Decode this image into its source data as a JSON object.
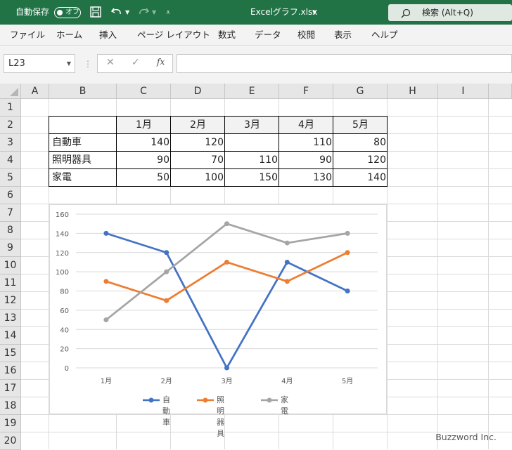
{
  "titlebar": {
    "autosave_label": "自動保存",
    "autosave_state": "オフ",
    "file_name": "Excelグラフ.xlsx",
    "search_label": "検索 (Alt+Q)",
    "bg_color": "#217346"
  },
  "menu": [
    "ファイル",
    "ホーム",
    "挿入",
    "ページ レイアウト",
    "数式",
    "データ",
    "校閲",
    "表示",
    "ヘルプ"
  ],
  "formula_bar": {
    "name_box": "L23",
    "fx": "fx",
    "formula": ""
  },
  "columns": [
    "A",
    "B",
    "C",
    "D",
    "E",
    "F",
    "G",
    "H",
    "I"
  ],
  "rows": [
    "1",
    "2",
    "3",
    "4",
    "5",
    "6",
    "7",
    "8",
    "9",
    "10",
    "11",
    "12",
    "13",
    "14",
    "15",
    "16",
    "17",
    "18",
    "19",
    "20"
  ],
  "table": {
    "headers": [
      "1月",
      "2月",
      "3月",
      "4月",
      "5月"
    ],
    "rows": [
      {
        "label": "自動車",
        "values": [
          "140",
          "120",
          "",
          "110",
          "80"
        ]
      },
      {
        "label": "照明器具",
        "values": [
          "90",
          "70",
          "110",
          "90",
          "120"
        ]
      },
      {
        "label": "家電",
        "values": [
          "50",
          "100",
          "150",
          "130",
          "140"
        ]
      }
    ]
  },
  "chart_data": {
    "type": "line",
    "categories": [
      "1月",
      "2月",
      "3月",
      "4月",
      "5月"
    ],
    "series": [
      {
        "name": "自動車",
        "values": [
          140,
          120,
          0,
          110,
          80
        ],
        "color": "#4472C4"
      },
      {
        "name": "照明器具",
        "values": [
          90,
          70,
          110,
          90,
          120
        ],
        "color": "#ED7D31"
      },
      {
        "name": "家電",
        "values": [
          50,
          100,
          150,
          130,
          140
        ],
        "color": "#A5A5A5"
      }
    ],
    "yticks": [
      "0",
      "20",
      "40",
      "60",
      "80",
      "100",
      "120",
      "140",
      "160"
    ],
    "ylim": [
      0,
      160
    ],
    "grid": true,
    "legend": "bottom"
  },
  "watermark": "Buzzword Inc."
}
